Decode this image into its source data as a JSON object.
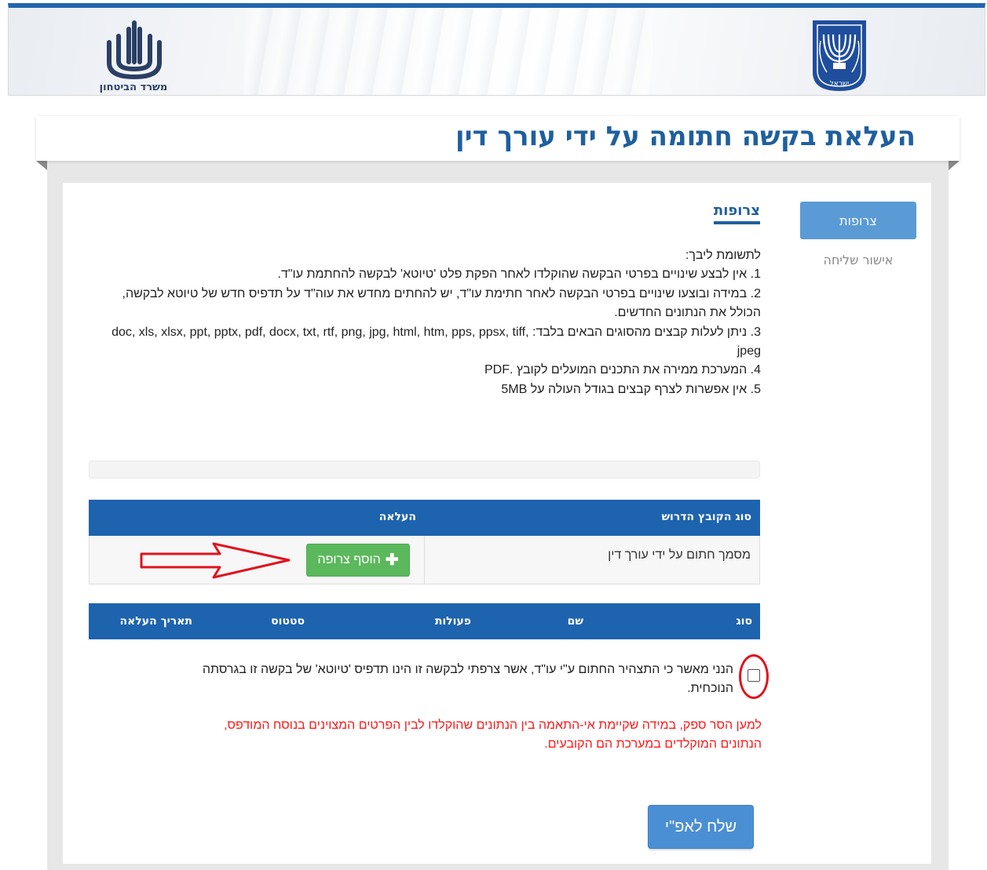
{
  "header": {
    "ministry_logo_text": "משרד הביטחון",
    "emblem_text": "ישראל",
    "brand_blue": "#2065ad"
  },
  "page_title": "העלאת בקשה חתומה על ידי עורך דין",
  "sidebar": {
    "items": [
      {
        "label": "צרופות",
        "active": true
      },
      {
        "label": "אישור שליחה",
        "active": false
      }
    ]
  },
  "section": {
    "title": "צרופות",
    "notes_heading": "לתשומת ליבך:",
    "notes": [
      "1. אין לבצע שינויים בפרטי הבקשה שהוקלדו לאחר הפקת פלט 'טיוטא' לבקשה להחתמת עו\"ד.",
      "2. במידה ובוצעו שינויים בפרטי הבקשה לאחר חתימת עו\"ד, יש להחתים מחדש את עוה\"ד על תדפיס חדש של טיוטא לבקשה, הכולל את הנתונים החדשים.",
      "3. ניתן לעלות קבצים מהסוגים הבאים בלבד:  doc, xls, xlsx, ppt, pptx, pdf, docx, txt, rtf, png, jpg, html, htm, pps, ppsx, tiff, jpeg",
      "4. המערכת ממירה את התכנים המועלים לקובץ  .PDF",
      "5. אין אפשרות לצרף קבצים בגודל העולה על 5MB"
    ]
  },
  "upload_table": {
    "headers": [
      "סוג הקובץ הדרוש",
      "העלאה"
    ],
    "rows": [
      {
        "file_type": "מסמך חתום על ידי עורך דין",
        "button": "הוסף צרופה"
      }
    ]
  },
  "files_table": {
    "headers": [
      "סוג",
      "שם",
      "פעולות",
      "סטטוס",
      "תאריך העלאה"
    ]
  },
  "confirm": {
    "checked": false,
    "text": "הנני מאשר כי התצהיר החתום ע\"י עו\"ד, אשר צרפתי לבקשה זו הינו תדפיס 'טיוטא' של בקשה זו בגרסתה הנוכחית."
  },
  "warning": "למען הסר ספק, במידה שקיימת אי-התאמה בין הנתונים שהוקלדו לבין הפרטים המצוינים בנוסח המודפס, הנתונים המוקלדים במערכת הם הקובעים.",
  "submit_label": "שלח לאפ\"י",
  "annotation_color": "#e0141e"
}
